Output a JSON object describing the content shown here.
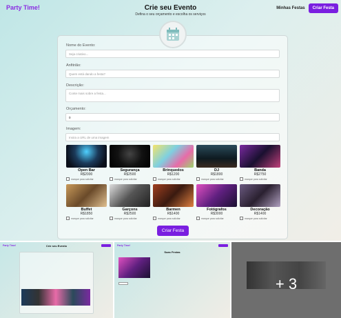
{
  "header": {
    "brand": "Party Time!",
    "title": "Crie seu Evento",
    "subtitle": "Defina o seu orçamento e escolha os serviços",
    "nav_link": "Minhas Festas",
    "nav_button": "Criar Festa"
  },
  "form": {
    "fields": [
      {
        "label": "Nome do Evento:",
        "placeholder": "Seja criativo..."
      },
      {
        "label": "Anfitrião:",
        "placeholder": "Quem está dando a festa?"
      },
      {
        "label": "Descrição:",
        "placeholder": "Conte mais sobre a festa..."
      },
      {
        "label": "Orçamento:",
        "value": "0"
      },
      {
        "label": "Imagem:",
        "placeholder": "Insira a URL de uma imagem"
      }
    ],
    "checkbox_label": "marque para solicitar",
    "submit": "Criar Festa"
  },
  "services": [
    {
      "name": "Open Bar",
      "price": "R$2000"
    },
    {
      "name": "Segurança",
      "price": "R$2500"
    },
    {
      "name": "Brinquedos",
      "price": "R$1200"
    },
    {
      "name": "DJ",
      "price": "R$1800"
    },
    {
      "name": "Banda",
      "price": "R$2750"
    },
    {
      "name": "Buffet",
      "price": "R$1850"
    },
    {
      "name": "Garçons",
      "price": "R$2500"
    },
    {
      "name": "Barmen",
      "price": "R$1400"
    },
    {
      "name": "Fotógrafos",
      "price": "R$3000"
    },
    {
      "name": "Decoração",
      "price": "R$1400"
    }
  ],
  "thumbnails": {
    "more_label": "+ 3",
    "thumb2_title": "Suas Festas"
  },
  "colors": {
    "accent": "#7a1fe0"
  }
}
